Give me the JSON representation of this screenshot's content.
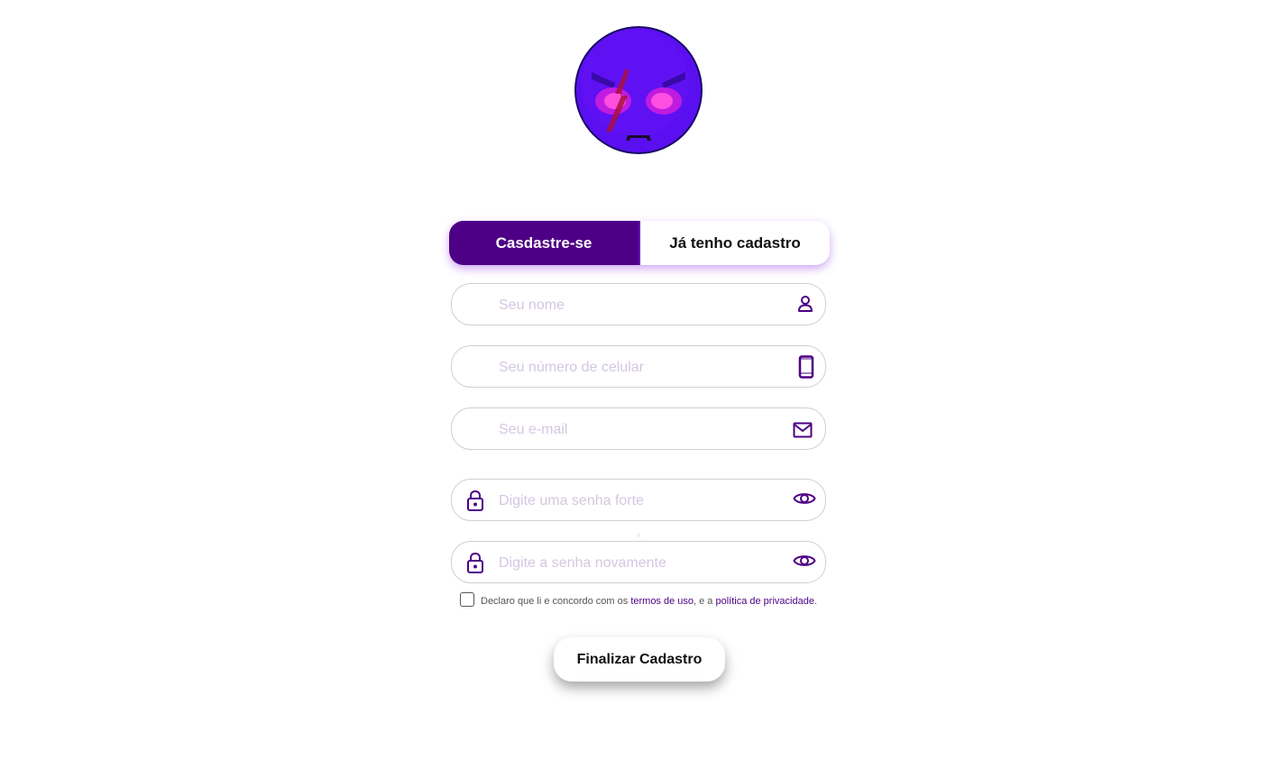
{
  "logo": {
    "icon": "angry-purple-face-logo",
    "colors": {
      "face": "#5a0ff0",
      "eyes": "#f022d8",
      "scar": "#b00c30"
    }
  },
  "tabs": {
    "register_label": "Casdastre-se",
    "login_label": "Já tenho cadastro"
  },
  "form": {
    "name": {
      "placeholder": "Seu nome",
      "icon": "user-icon"
    },
    "phone": {
      "placeholder": "Seu número de celular",
      "icon": "phone-icon"
    },
    "email": {
      "placeholder": "Seu e-mail",
      "icon": "mail-icon"
    },
    "password": {
      "placeholder": "Digite uma senha forte",
      "icon": "lock-icon",
      "toggle_icon": "eye-icon"
    },
    "password_confirm": {
      "placeholder": "Digite a senha novamente",
      "icon": "lock-icon",
      "toggle_icon": "eye-icon"
    }
  },
  "terms": {
    "checked": false,
    "prefix": "Declaro que li e concordo com os ",
    "terms_link": "termos de uso",
    "middle": ", e a ",
    "privacy_link": "política de privacidade",
    "suffix": "."
  },
  "submit_label": "Finalizar Cadastro",
  "colors": {
    "accent": "#4d0085",
    "placeholder": "#d4c6e2",
    "tab_glow": "#9a3ce6"
  }
}
